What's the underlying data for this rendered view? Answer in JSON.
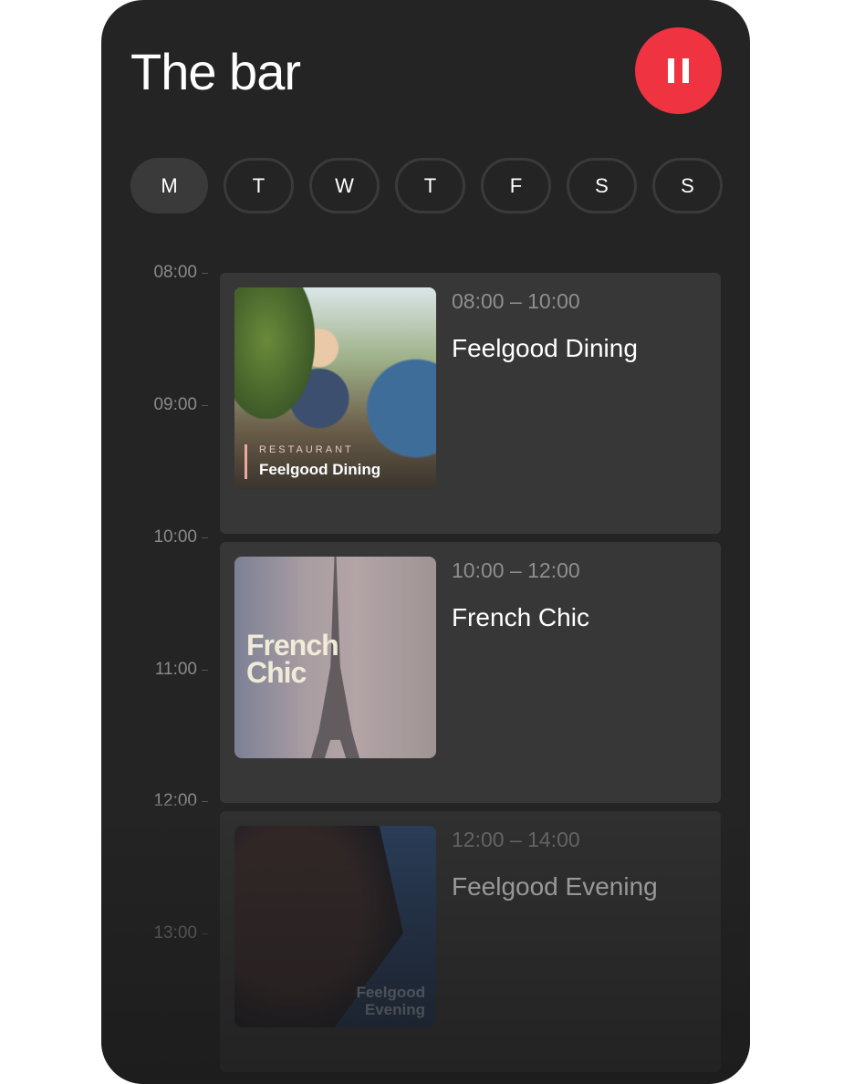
{
  "header": {
    "title": "The bar",
    "pause_button": {
      "icon": "pause-icon",
      "color": "#ef3340"
    }
  },
  "days": [
    {
      "label": "M",
      "active": true
    },
    {
      "label": "T",
      "active": false
    },
    {
      "label": "W",
      "active": false
    },
    {
      "label": "T",
      "active": false
    },
    {
      "label": "F",
      "active": false
    },
    {
      "label": "S",
      "active": false
    },
    {
      "label": "S",
      "active": false
    }
  ],
  "timeline": {
    "hours": [
      "08:00",
      "09:00",
      "10:00",
      "11:00",
      "12:00",
      "13:00"
    ]
  },
  "slots": [
    {
      "time": "08:00 – 10:00",
      "name": "Feelgood Dining",
      "artwork": {
        "category": "RESTAURANT",
        "title": "Feelgood Dining"
      }
    },
    {
      "time": "10:00 – 12:00",
      "name": "French Chic",
      "artwork": {
        "title_line1": "French",
        "title_line2": "Chic"
      }
    },
    {
      "time": "12:00 – 14:00",
      "name": "Feelgood Evening",
      "artwork": {
        "title_line1": "Feelgood",
        "title_line2": "Evening"
      }
    }
  ]
}
